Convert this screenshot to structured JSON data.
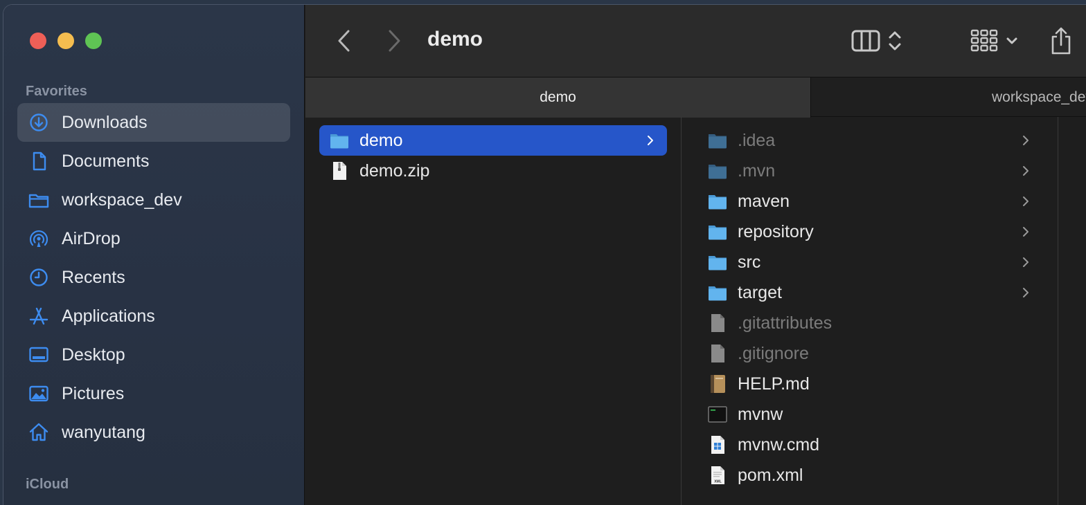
{
  "sidebar": {
    "favorites_title": "Favorites",
    "icloud_title": "iCloud",
    "items": [
      {
        "label": "Downloads",
        "icon": "download-icon"
      },
      {
        "label": "Documents",
        "icon": "document-icon"
      },
      {
        "label": "workspace_dev",
        "icon": "folder-icon"
      },
      {
        "label": "AirDrop",
        "icon": "airdrop-icon"
      },
      {
        "label": "Recents",
        "icon": "clock-icon"
      },
      {
        "label": "Applications",
        "icon": "applications-icon"
      },
      {
        "label": "Desktop",
        "icon": "desktop-icon"
      },
      {
        "label": "Pictures",
        "icon": "pictures-icon"
      },
      {
        "label": "wanyutang",
        "icon": "home-icon"
      }
    ]
  },
  "toolbar": {
    "title": "demo",
    "back_icon": "chevron-left-icon",
    "forward_icon": "chevron-right-icon",
    "view_icon": "columns-view-icon",
    "group_icon": "grid-icon",
    "share_icon": "share-icon"
  },
  "tabs": [
    {
      "label": "demo",
      "active": true
    },
    {
      "label": "workspace_dev",
      "active": false
    }
  ],
  "column1": [
    {
      "name": "demo",
      "type": "folder",
      "selected": true
    },
    {
      "name": "demo.zip",
      "type": "zip"
    }
  ],
  "column2": [
    {
      "name": ".idea",
      "type": "folder",
      "hidden": true
    },
    {
      "name": ".mvn",
      "type": "folder",
      "hidden": true
    },
    {
      "name": "maven",
      "type": "folder"
    },
    {
      "name": "repository",
      "type": "folder"
    },
    {
      "name": "src",
      "type": "folder"
    },
    {
      "name": "target",
      "type": "folder"
    },
    {
      "name": ".gitattributes",
      "type": "file",
      "hidden": true
    },
    {
      "name": ".gitignore",
      "type": "file",
      "hidden": true
    },
    {
      "name": "HELP.md",
      "type": "markdown"
    },
    {
      "name": "mvnw",
      "type": "terminal"
    },
    {
      "name": "mvnw.cmd",
      "type": "windows"
    },
    {
      "name": "pom.xml",
      "type": "xml"
    }
  ],
  "colors": {
    "accent": "#2656c9",
    "folder": "#62b4ee",
    "sidebar_icon": "#3d8cf0"
  }
}
